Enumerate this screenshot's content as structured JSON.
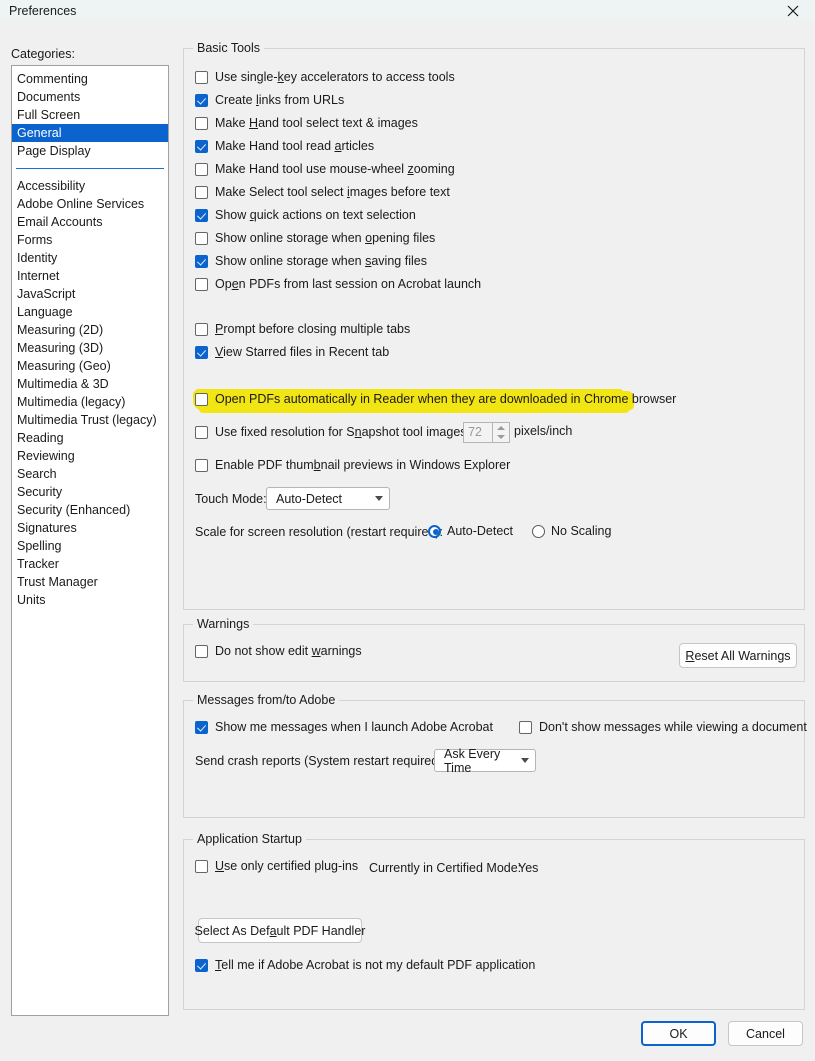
{
  "window": {
    "title": "Preferences",
    "close_icon": "close-icon"
  },
  "sidebar": {
    "label": "Categories:",
    "selected": "General",
    "primary_items": [
      "Commenting",
      "Documents",
      "Full Screen",
      "General",
      "Page Display"
    ],
    "secondary_items": [
      "Accessibility",
      "Adobe Online Services",
      "Email Accounts",
      "Forms",
      "Identity",
      "Internet",
      "JavaScript",
      "Language",
      "Measuring (2D)",
      "Measuring (3D)",
      "Measuring (Geo)",
      "Multimedia & 3D",
      "Multimedia (legacy)",
      "Multimedia Trust (legacy)",
      "Reading",
      "Reviewing",
      "Search",
      "Security",
      "Security (Enhanced)",
      "Signatures",
      "Spelling",
      "Tracker",
      "Trust Manager",
      "Units"
    ]
  },
  "basic_tools": {
    "legend": "Basic Tools",
    "checkboxes": [
      {
        "label": "Use single-key accelerators to access tools",
        "checked": false,
        "accel": "k"
      },
      {
        "label": "Create links from URLs",
        "checked": true,
        "accel": "l"
      },
      {
        "label": "Make Hand tool select text & images",
        "checked": false,
        "accel": "H"
      },
      {
        "label": "Make Hand tool read articles",
        "checked": true,
        "accel": "a"
      },
      {
        "label": "Make Hand tool use mouse-wheel zooming",
        "checked": false,
        "accel": "z"
      },
      {
        "label": "Make Select tool select images before text",
        "checked": false,
        "accel": "i"
      },
      {
        "label": "Show quick actions on text selection",
        "checked": true,
        "accel": "q"
      },
      {
        "label": "Show online storage when opening files",
        "checked": false,
        "accel": "o"
      },
      {
        "label": "Show online storage when saving files",
        "checked": true,
        "accel": "s"
      },
      {
        "label": "Open PDFs from last session on Acrobat launch",
        "checked": false,
        "accel": "e"
      },
      {
        "label": "Prompt before closing multiple tabs",
        "checked": false,
        "accel": "P"
      },
      {
        "label": "View Starred files in Recent tab",
        "checked": true,
        "accel": "V"
      },
      {
        "label": "Open PDFs automatically in Reader when they are downloaded in Chrome browser",
        "checked": false,
        "accel": ""
      },
      {
        "label": "Use fixed resolution for Snapshot tool images:",
        "checked": false,
        "accel": "n"
      },
      {
        "label": "Enable PDF thumbnail previews in Windows Explorer",
        "checked": false,
        "accel": "b"
      }
    ],
    "snapshot_resolution": {
      "value": "72",
      "unit": "pixels/inch",
      "enabled": false
    },
    "touch_mode": {
      "label": "Touch Mode:",
      "value": "Auto-Detect"
    },
    "scale": {
      "label": "Scale for screen resolution (restart required):",
      "options": [
        "Auto-Detect",
        "No Scaling"
      ],
      "selected": "Auto-Detect"
    },
    "highlight_color": "#f2e514"
  },
  "warnings": {
    "legend": "Warnings",
    "checkbox": {
      "label": "Do not show edit warnings",
      "checked": false,
      "accel": "w"
    },
    "reset_button": "Reset All Warnings",
    "reset_accel": "R"
  },
  "messages": {
    "legend": "Messages from/to Adobe",
    "show_on_launch": {
      "label": "Show me messages when I launch Adobe Acrobat",
      "checked": true
    },
    "dont_show_viewing": {
      "label": "Don't show messages while viewing a document",
      "checked": false
    },
    "crash_label": "Send crash reports (System restart required):",
    "crash_value": "Ask Every Time"
  },
  "startup": {
    "legend": "Application Startup",
    "certified_plugins": {
      "label": "Use only certified plug-ins",
      "checked": false,
      "accel": "U"
    },
    "certified_mode_label": "Currently in Certified Mode:",
    "certified_mode_value": "Yes",
    "default_handler_button": "Select As Default PDF Handler",
    "default_handler_accel": "a",
    "tell_me_default": {
      "label": "Tell me if Adobe Acrobat is not my default PDF application",
      "checked": true,
      "accel": "T"
    }
  },
  "footer": {
    "ok": "OK",
    "cancel": "Cancel"
  },
  "colors": {
    "accent": "#0b63ce",
    "dialog_bg": "#f0f0f0",
    "titlebar_bg": "#eef4f4",
    "highlight": "#f2e514"
  }
}
